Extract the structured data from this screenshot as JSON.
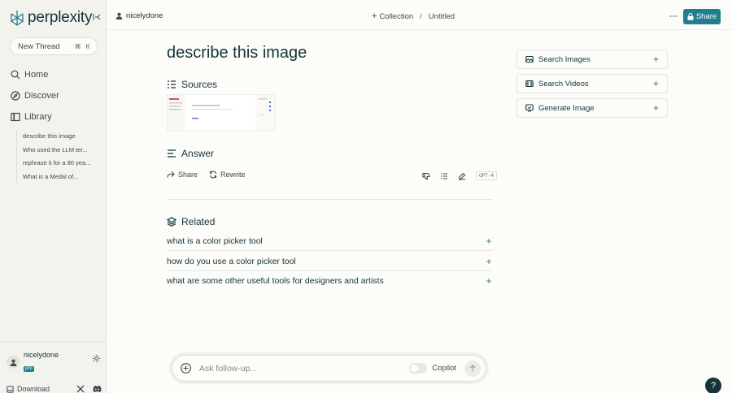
{
  "app": {
    "name": "perplexity"
  },
  "sidebar": {
    "new_thread": "New Thread",
    "shortcut": [
      "⌘",
      "K"
    ],
    "nav": [
      {
        "label": "Home",
        "icon": "search-icon"
      },
      {
        "label": "Discover",
        "icon": "compass-icon"
      },
      {
        "label": "Library",
        "icon": "library-icon"
      }
    ],
    "library_items": [
      "describe this image",
      "Who used the LLM ter...",
      "rephrase it for a 80 yea...",
      "What is a Medal of..."
    ],
    "user": {
      "name": "nicelydone",
      "badge": "pro"
    },
    "download": "Download"
  },
  "header": {
    "user": "nicelydone",
    "collection": "Collection",
    "separator": "/",
    "page": "Untitled",
    "share": "Share"
  },
  "main": {
    "title": "describe this image",
    "sources_label": "Sources",
    "answer_label": "Answer",
    "share": "Share",
    "rewrite": "Rewrite",
    "model": "GPT-4",
    "related_label": "Related",
    "related": [
      "what is a color picker tool",
      "how do you use a color picker tool",
      "what are some other useful tools for designers and artists"
    ]
  },
  "side_actions": [
    {
      "label": "Search Images",
      "icon": "image-icon"
    },
    {
      "label": "Search Videos",
      "icon": "video-icon"
    },
    {
      "label": "Generate Image",
      "icon": "generate-image-icon"
    }
  ],
  "followup": {
    "placeholder": "Ask follow-up...",
    "copilot": "Copilot"
  },
  "help": "?",
  "colors": {
    "accent": "#1f7f8e",
    "text": "#13343b",
    "background": "#fcfcf9",
    "sidebar": "#f3f3ee"
  }
}
